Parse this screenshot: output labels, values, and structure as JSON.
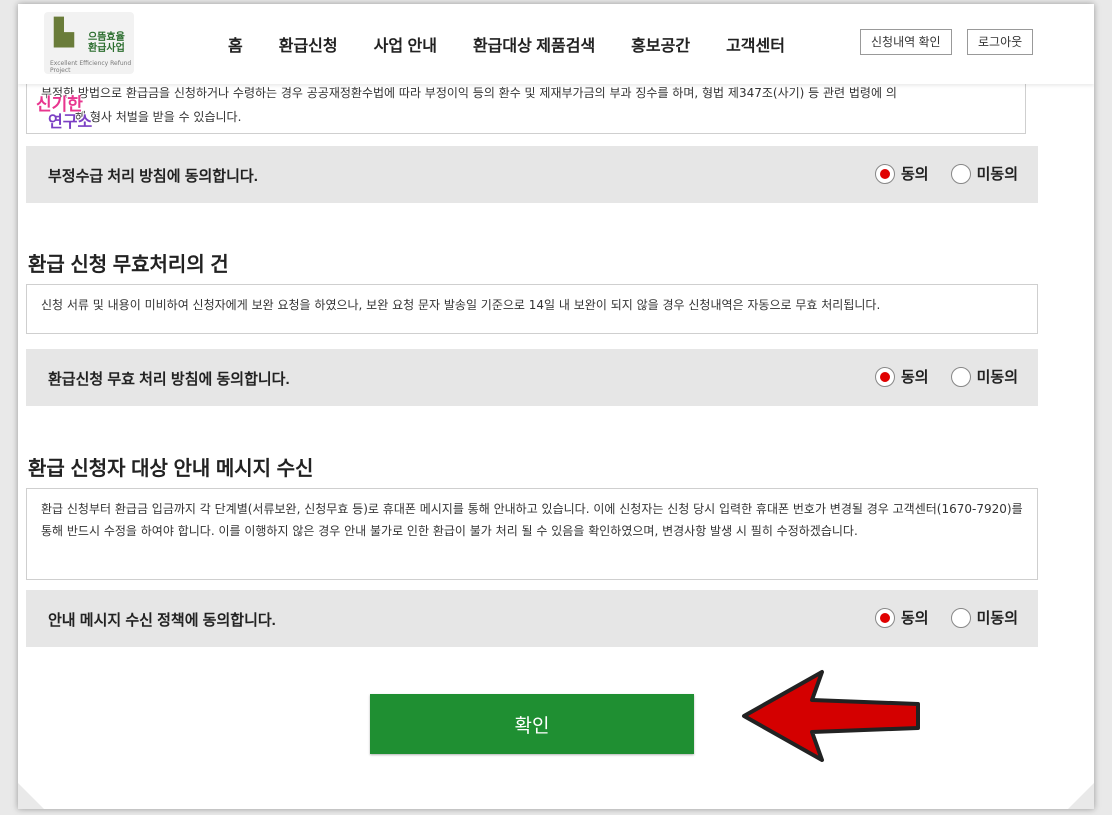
{
  "header": {
    "logo_text": "으뜸효율 환급사업",
    "logo_sub": "Excellent Efficiency Refund Project",
    "nav": [
      "홈",
      "환급신청",
      "사업 안내",
      "환급대상 제품검색",
      "홍보공간",
      "고객센터"
    ],
    "btn_check": "신청내역 확인",
    "btn_logout": "로그아웃"
  },
  "badge": {
    "line1": "신기한",
    "line2": "연구소"
  },
  "top_notice": {
    "line1": "부정한 방법으로 환급금을 신청하거나 수령하는 경우 공공재정환수법에 따라 부정이익 등의 환수 및 제재부가금의 부과 징수를 하며, 형법 제347조(사기) 등 관련 법령에 의",
    "line2": "해 형사 처벌을 받을 수 있습니다."
  },
  "sections": [
    {
      "agree_label": "부정수급 처리 방침에 동의합니다.",
      "agree": "동의",
      "disagree": "미동의"
    },
    {
      "title": "환급 신청 무효처리의 건",
      "notice": "신청 서류 및 내용이 미비하여 신청자에게 보완 요청을 하였으나, 보완 요청 문자 발송일 기준으로 14일 내 보완이 되지 않을 경우 신청내역은 자동으로 무효 처리됩니다.",
      "agree_label": "환급신청 무효 처리 방침에 동의합니다.",
      "agree": "동의",
      "disagree": "미동의"
    },
    {
      "title": "환급 신청자 대상 안내 메시지 수신",
      "notice": "환급 신청부터 환급금 입금까지 각 단계별(서류보완, 신청무효 등)로 휴대폰 메시지를 통해 안내하고 있습니다. 이에 신청자는 신청 당시 입력한 휴대폰 번호가 변경될 경우 고객센터(1670-7920)를 통해 반드시 수정을 하여야 합니다. 이를 이행하지 않은 경우 안내 불가로 인한 환급이 불가 처리 될 수 있음을 확인하였으며, 변경사항 발생 시 필히 수정하겠습니다.",
      "agree_label": "안내 메시지 수신 정책에 동의합니다.",
      "agree": "동의",
      "disagree": "미동의"
    }
  ],
  "confirm_label": "확인",
  "colors": {
    "confirm": "#1f8f32",
    "radio_on": "#e00000",
    "arrow": "#d40000"
  }
}
